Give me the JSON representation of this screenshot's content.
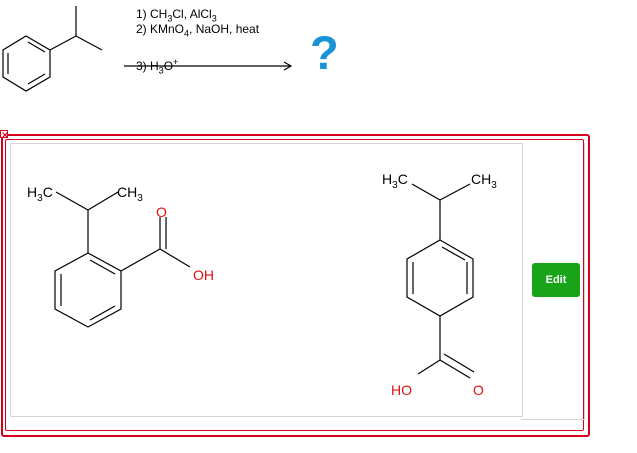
{
  "reaction": {
    "conditions": {
      "step1_prefix": "1) CH",
      "step1_sub1": "3",
      "step1_mid": "Cl, AlCl",
      "step1_sub2": "3",
      "step2_prefix": "2) KMnO",
      "step2_sub": "4",
      "step2_suffix": ", NaOH, heat",
      "step3_prefix": "3) H",
      "step3_sub": "3",
      "step3_mid": "O",
      "step3_sup": "+"
    },
    "unknown_product": "?"
  },
  "answer_panel": {
    "edit_label": "Edit",
    "molecule_left": {
      "methyl_a_h": "H",
      "methyl_a_sub": "3",
      "methyl_a_c": "C",
      "methyl_b_ch": "CH",
      "methyl_b_sub": "3",
      "carbonyl_o": "O",
      "hydroxyl": "OH"
    },
    "molecule_right": {
      "methyl_a_h": "H",
      "methyl_a_sub": "3",
      "methyl_a_c": "C",
      "methyl_b_ch": "CH",
      "methyl_b_sub": "3",
      "hydroxyl": "HO",
      "carbonyl_o": "O"
    }
  },
  "colors": {
    "frame_red": "#d6001c",
    "question_blue": "#1a92d6",
    "edit_green": "#18a318",
    "oxygen_red": "#e01010"
  },
  "icons": [
    "close-icon",
    "reaction-arrow-icon"
  ]
}
